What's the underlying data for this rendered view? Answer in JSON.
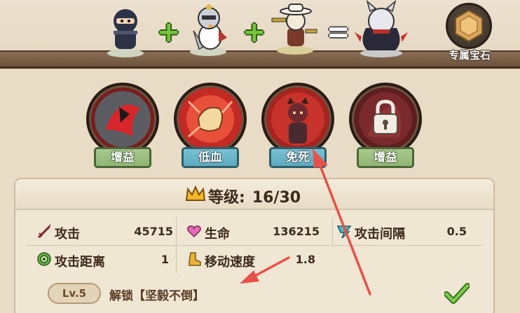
{
  "header": {
    "gem_button_label": "专属宝石"
  },
  "skills": [
    {
      "tag": "增益",
      "style": "green"
    },
    {
      "tag": "低血",
      "style": "blue"
    },
    {
      "tag": "免死",
      "style": "blue"
    },
    {
      "tag": "增益",
      "style": "green"
    }
  ],
  "level": {
    "label": "等级:",
    "value": "16/30"
  },
  "stats": {
    "attack": {
      "label": "攻击",
      "value": "45715"
    },
    "hp": {
      "label": "生命",
      "value": "136215"
    },
    "attack_interval": {
      "label": "攻击间隔",
      "value": "0.5"
    },
    "attack_range": {
      "label": "攻击距离",
      "value": "1"
    },
    "move_speed": {
      "label": "移动速度",
      "value": "1.8"
    }
  },
  "unlock": {
    "level_badge": "Lv.5",
    "text": "解锁【坚毅不倒】"
  },
  "colors": {
    "accent_green": "#77c43b",
    "tag_blue": "#5ea9bd",
    "tag_green": "#8fb574",
    "annotation_arrow": "#e8504a"
  }
}
